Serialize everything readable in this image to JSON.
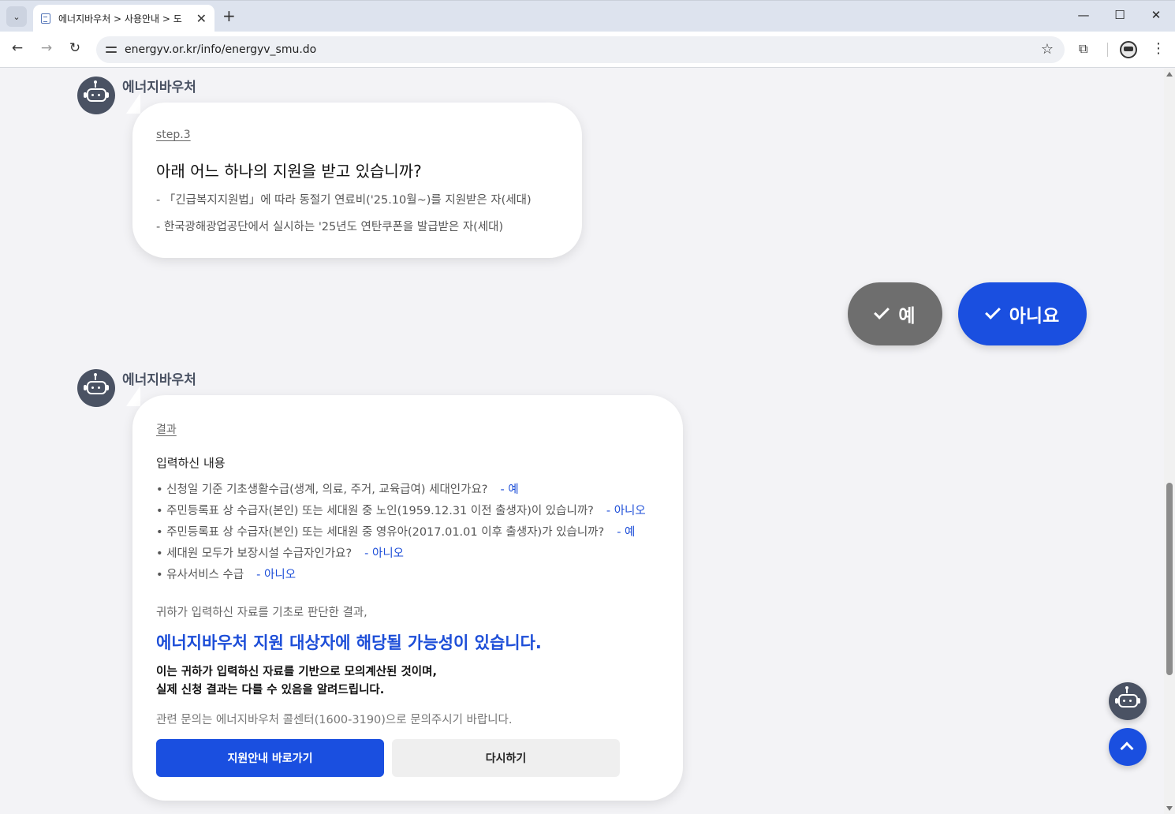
{
  "browser": {
    "tab_title": "에너지바우처 > 사용안내 > 도",
    "tab_menu_icon": "chevron-down-icon",
    "new_tab": "+",
    "close": "✕",
    "url": "energyv.or.kr/info/energyv_smu.do",
    "window_controls": {
      "minimize": "—",
      "maximize": "☐",
      "close": "✕"
    },
    "nav": {
      "back": "←",
      "forward": "→",
      "reload": "↻"
    },
    "star": "☆",
    "extensions": "⧉",
    "menu": "⋮"
  },
  "bot_name": "에너지바우처",
  "step_bubble": {
    "step_label": "step.3",
    "question": "아래 어느 하나의 지원을 받고 있습니까?",
    "conditions": [
      "- 「긴급복지지원법」에 따라 동절기 연료비('25.10월~)를 지원받은 자(세대)",
      "- 한국광해광업공단에서 실시하는 '25년도 연탄쿠폰을 발급받은 자(세대)"
    ]
  },
  "answers": {
    "yes_label": "예",
    "no_label": "아니요",
    "yes_color": "#6e6e6e",
    "no_color": "#1a4fe0"
  },
  "result_bubble": {
    "section_label": "결과",
    "input_heading": "입력하신 내용",
    "items": [
      {
        "question": "신청일 기준 기초생활수급(생계, 의료, 주거, 교육급여) 세대인가요?",
        "answer": "- 예"
      },
      {
        "question": "주민등록표 상 수급자(본인) 또는 세대원 중 노인(1959.12.31 이전 출생자)이 있습니까?",
        "answer": "- 아니오"
      },
      {
        "question": "주민등록표 상 수급자(본인) 또는 세대원 중 영유아(2017.01.01 이후 출생자)가 있습니까?",
        "answer": "- 예"
      },
      {
        "question": "세대원 모두가 보장시설 수급자인가요?",
        "answer": "- 아니오"
      },
      {
        "question": "유사서비스 수급",
        "answer": "- 아니오"
      }
    ],
    "basis": "귀하가 입력하신 자료를 기초로 판단한 결과,",
    "result_title": "에너지바우처 지원 대상자에 해당될 가능성이 있습니다.",
    "notice_line1": "이는 귀하가 입력하신 자료를 기반으로 모의계산된 것이며,",
    "notice_line2": "실제 신청 결과는 다를 수 있음을 알려드립니다.",
    "contact": "관련 문의는 에너지바우처 콜센터(1600-3190)으로 문의주시기 바랍니다.",
    "primary_button": "지원안내 바로가기",
    "secondary_button": "다시하기"
  },
  "colors": {
    "accent": "#1a4fe0",
    "bot_avatar": "#4a5263",
    "page_bg": "#f3f3f6"
  }
}
